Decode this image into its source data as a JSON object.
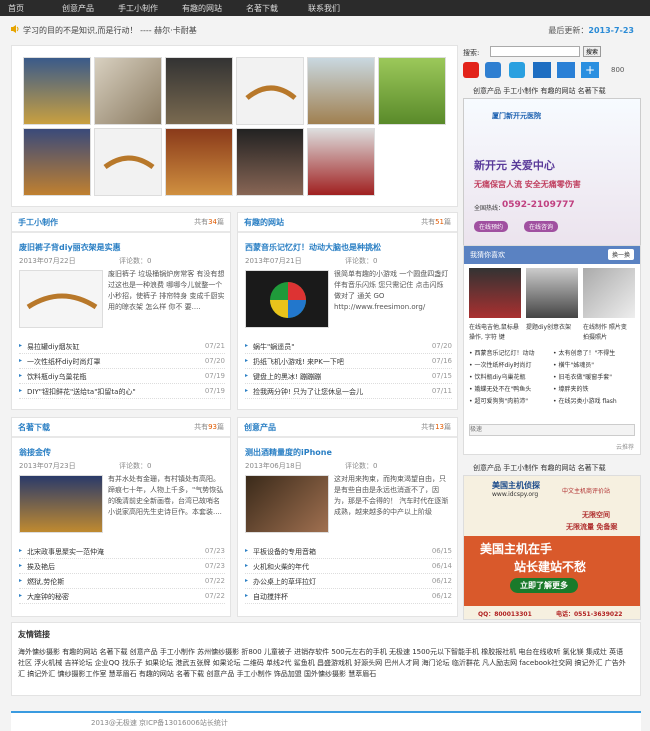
{
  "nav": {
    "items": [
      "首页",
      "创意产品",
      "手工小制作",
      "有趣的网站",
      "名著下载",
      "联系我们"
    ]
  },
  "notice": {
    "text": "学习的目的不是知识,而是行动！ ---- 赫尔·卡耐基",
    "updated_label": "最后更新：",
    "updated_date": "2013-7-23"
  },
  "search": {
    "label": "搜索:",
    "button": "搜索"
  },
  "share": {
    "count": "800"
  },
  "sidebar": {
    "links1": "创意产品 手工小制作 有趣的网站 名著下载",
    "ad1": {
      "logo": "厦门新开元医院",
      "headline": "新开元 关爱中心",
      "sub": "无痛保宫人流 安全无痛零伤害",
      "phone_label": "全国热线：",
      "phone": "0592-2109777",
      "btn1": "在线预约",
      "btn2": "在线咨询"
    },
    "hot_title": "我猜你喜欢",
    "hot_switch": "换一换",
    "hot_caption1": "在线电吉他,鼠标悬",
    "hot_caption1b": "操作, 字符 键",
    "hot_caption2": "提题diy创意衣架",
    "hot_caption3": "在线制作 照片变",
    "hot_caption3b": "拍摄照片",
    "hot_list": [
      [
        "• 西蒙音乐记忆灯！动动",
        "• 太有创意了！\"不得生"
      ],
      [
        "• 一次性纸杯diy时尚灯",
        "• 横牛\"姊魂员\""
      ],
      [
        "• 饮料瓶diy乌巢花瓶",
        "• 旧毛衣做\"暖窗手套\""
      ],
      [
        "• 娥蝶无处不在\"鸭鱼头",
        "• 壕胖夹的铁"
      ],
      [
        "• 超可爱狗狗\"肉前沛\"",
        "• 在线另类小游戏 flash"
      ]
    ],
    "hot_search_placeholder": "极速",
    "hot_footer": "云推荐",
    "links2": "创意产品 手工小制作 有趣的网站 名著下载",
    "ad2": {
      "brand": "美国主机侦探",
      "url": "www.idcspy.org",
      "slogan": "中文主机商评价站",
      "line1": "无限空间",
      "line2": "无限流量 免备案",
      "big1": "美国主机在手",
      "big2": "站长建站不愁",
      "cta": "立即了解更多",
      "qq": "QQ：800013301",
      "tel": "电话：0551-3639022"
    }
  },
  "sections": [
    {
      "title": "手工小制作",
      "count_pre": "共有",
      "count": "34",
      "count_post": "篇",
      "headline": "废旧裤子背diy丽衣架是实惠",
      "date": "2013年07月22日",
      "comments": "评论数：0",
      "summary": "废旧裤子 垃圾桶锅炉房常客 有没有想过这也是一种浪费 哪哪今儿就整一个小秒招，使裤子 排帘特身 变成千厨实用的晾衣架 怎么样 你不 要....",
      "items": [
        [
          "易拉罐diy烟灰缸",
          "07/21"
        ],
        [
          "一次性纸杯diy时尚灯罩",
          "07/20"
        ],
        [
          "饮料瓶diy乌巢花瓶",
          "07/19"
        ],
        [
          "DIY\"钮扣鲜花\"送给ta\"扣留ta的心\"",
          "07/19"
        ]
      ]
    },
    {
      "title": "有趣的网站",
      "count_pre": "共有",
      "count": "51",
      "count_post": "篇",
      "headline": "西蒙音乐记忆灯！动动大脑也是种挑松",
      "date": "2013年07月21日",
      "comments": "评论数：0",
      "summary": "很简单有趣的小游戏 一个圆盘四盏灯 伴有音乐闪烁 您只需记住 点击闪烁 做对了 通关 GO http://www.freesimon.org/",
      "items": [
        [
          "蜗牛\"蜗遥员\"",
          "07/20"
        ],
        [
          "扔纸飞机小游戏! 来PK一下吧",
          "07/16"
        ],
        [
          "键盘上的黑冰! 蹦蹦蹦",
          "07/15"
        ],
        [
          "捡我两分钟! 只为了让您休息一会儿",
          "07/11"
        ]
      ]
    },
    {
      "title": "名著下载",
      "count_pre": "共有",
      "count": "93",
      "count_post": "篇",
      "headline": "翁接金传",
      "date": "2013年07月23日",
      "comments": "评论数：0",
      "summary": "有并水处有金珊，有村镇处有高阳。蹄痕七十年，人物上千多，\"气势恢弘的晚清前史全新画卷，台湾已故哨名小说家高阳先生史诗巨作。本套装....",
      "items": [
        [
          "北宋政事思聚实一范仲淹",
          "07/23"
        ],
        [
          "挨及艳后",
          "07/23"
        ],
        [
          "燃狱,劳伦斯",
          "07/22"
        ],
        [
          "大座钟的秘密",
          "07/22"
        ]
      ]
    },
    {
      "title": "创意产品",
      "count_pre": "共有",
      "count": "13",
      "count_post": "篇",
      "headline": "测出酒精量度的iPhone",
      "date": "2013年06月18日",
      "comments": "评论数：0",
      "summary": "这对用来拘束，而拘束渴望自由，只是有些自由是永远也消逝不了，因为，那是不会得的！ 汽车时代在逐渐成熟，越来越多的中产以上阶级",
      "items": [
        [
          "平板设备的专用音箱",
          "06/15"
        ],
        [
          "火机和火柴的年代",
          "06/14"
        ],
        [
          "办公桌上的草坪拉灯",
          "06/12"
        ],
        [
          "自动搅拌杯",
          "06/12"
        ]
      ]
    }
  ],
  "friends": {
    "title": "友情链接",
    "text": "海外慵纱摄影 有趣的网站 名著下载 创意产品 手工小制作 苏州慵纱摄影 折800 儿童被子 进销存软件 500元左右的手机 无极速 1500元以下智能手机 橡胶报社机 电台在线收听 氯化镁 集成灶 英语社区 浮火机械 吉祥论坛 企业QQ 找乐子 如果论坛 港武五张牌 如果论坛 二维码 单线2代 鲨鱼机 昌盛游戏机 好源头网 巴州人才网 海门论坛 临沂群花 凡人励志网 facebook社交网 搞记外汇 广告外汇 搞记外汇 慵纱摄影工作室 慧萃眉石 有趣的网站 名著下载 创意产品 手工小制作 饰品加盟 国外慵纱摄影 慧萃眉石"
  },
  "footer": {
    "text": "2013@无极速 京ICP备13016006站长统计"
  }
}
